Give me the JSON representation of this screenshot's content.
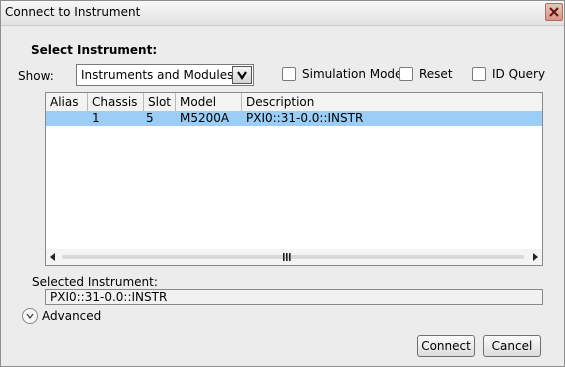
{
  "window": {
    "title": "Connect to Instrument"
  },
  "select_section": {
    "heading": "Select Instrument:",
    "show_label": "Show:",
    "show_value": "Instruments and Modules"
  },
  "options": {
    "simulation_mode": {
      "label": "Simulation Mode",
      "checked": false
    },
    "reset": {
      "label": "Reset",
      "checked": false
    },
    "id_query": {
      "label": "ID Query",
      "checked": false
    }
  },
  "grid": {
    "columns": [
      "Alias",
      "Chassis",
      "Slot",
      "Model",
      "Description"
    ],
    "rows": [
      {
        "alias": "",
        "chassis": "1",
        "slot": "5",
        "model": "M5200A",
        "description": "PXI0::31-0.0::INSTR",
        "selected": true
      }
    ]
  },
  "selected_instrument": {
    "label": "Selected Instrument:",
    "value": "PXI0::31-0.0::INSTR"
  },
  "advanced": {
    "label": "Advanced"
  },
  "buttons": {
    "connect": "Connect",
    "cancel": "Cancel"
  },
  "colors": {
    "selected_row": "#9ccdf4",
    "dialog_background": "#ececec",
    "close_button": "#d9958a"
  }
}
